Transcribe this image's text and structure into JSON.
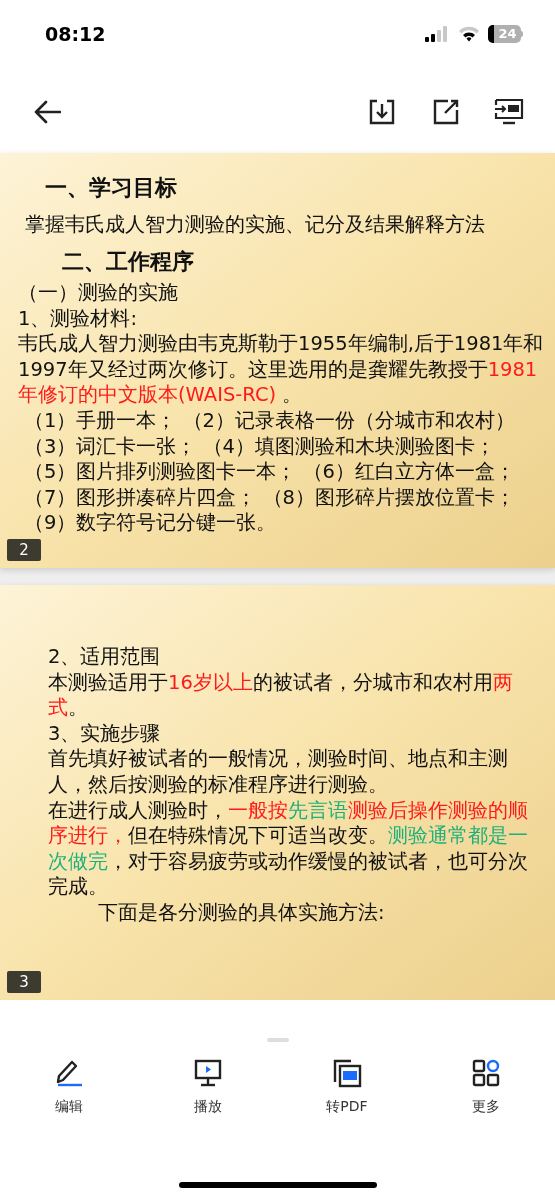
{
  "status_bar": {
    "time": "08:12",
    "battery": "24"
  },
  "slides": [
    {
      "page": "2",
      "blocks": [
        {
          "kind": "heading",
          "segments": [
            {
              "text": "一、学习目标"
            }
          ]
        },
        {
          "kind": "subtitle",
          "segments": [
            {
              "text": "掌握韦氏成人智力测验的实施、记分及结果解释方法"
            }
          ]
        },
        {
          "kind": "heading2",
          "segments": [
            {
              "text": "二、工作程序"
            }
          ]
        },
        {
          "kind": "text",
          "segments": [
            {
              "text": "（一）测验的实施"
            }
          ]
        },
        {
          "kind": "text",
          "segments": [
            {
              "text": "1、测验材料:"
            }
          ]
        },
        {
          "kind": "text",
          "segments": [
            {
              "text": "韦氏成人智力测验由韦克斯勒于1955年编制,后于1981年和 1997年又经过两次修订。这里选用的是龚耀先教授于"
            },
            {
              "text": "1981年修订的中文版本(WAIS-RC)",
              "color": "#ff1a1a"
            },
            {
              "text": " 。"
            }
          ]
        },
        {
          "kind": "list",
          "segments": [
            {
              "text": "（1）手册一本；  （2）记录表格一份（分城市和农村）"
            }
          ]
        },
        {
          "kind": "list",
          "segments": [
            {
              "text": "（3）词汇卡一张；  （4）填图测验和木块测验图卡；"
            }
          ]
        },
        {
          "kind": "list",
          "segments": [
            {
              "text": "（5）图片排列测验图卡一本；  （6）红白立方体一盒；"
            }
          ]
        },
        {
          "kind": "list",
          "segments": [
            {
              "text": "（7）图形拼凑碎片四盒；  （8）图形碎片摆放位置卡；"
            }
          ]
        },
        {
          "kind": "list",
          "segments": [
            {
              "text": "（9）数字符号记分键一张。"
            }
          ]
        }
      ]
    },
    {
      "page": "3",
      "blocks": [
        {
          "kind": "text",
          "segments": [
            {
              "text": "2、适用范围"
            }
          ]
        },
        {
          "kind": "text",
          "segments": [
            {
              "text": "本测验适用于"
            },
            {
              "text": "16岁以上",
              "color": "#ff1a1a"
            },
            {
              "text": "的被试者，分城市和农村用"
            },
            {
              "text": "两式",
              "color": "#ff1a1a"
            },
            {
              "text": "。"
            }
          ]
        },
        {
          "kind": "text",
          "segments": [
            {
              "text": "3、实施步骤"
            }
          ]
        },
        {
          "kind": "text",
          "segments": [
            {
              "text": "首先填好被试者的一般情况，测验时间、地点和主测人，然后按测验的标准程序进行测验。"
            }
          ]
        },
        {
          "kind": "text",
          "segments": [
            {
              "text": "在进行成人测验时，"
            },
            {
              "text": "一般按",
              "color": "#ff1a1a"
            },
            {
              "text": "先言语",
              "color": "#1fb07a"
            },
            {
              "text": "测验后操作测验的顺序进行，",
              "color": "#ff1a1a"
            },
            {
              "text": "但在特殊情况下可适当改变。"
            },
            {
              "text": "测验通常都是一次做完",
              "color": "#1fb07a"
            },
            {
              "text": "，对于容易疲劳或动作缓慢的被试者，也可分次完成。"
            }
          ]
        },
        {
          "kind": "indented",
          "segments": [
            {
              "text": "下面是各分测验的具体实施方法:"
            }
          ]
        }
      ]
    }
  ],
  "actions": [
    {
      "kind": "edit",
      "label": "编辑"
    },
    {
      "kind": "play",
      "label": "播放"
    },
    {
      "kind": "pdf",
      "label": "转PDF"
    },
    {
      "kind": "more",
      "label": "更多"
    }
  ]
}
